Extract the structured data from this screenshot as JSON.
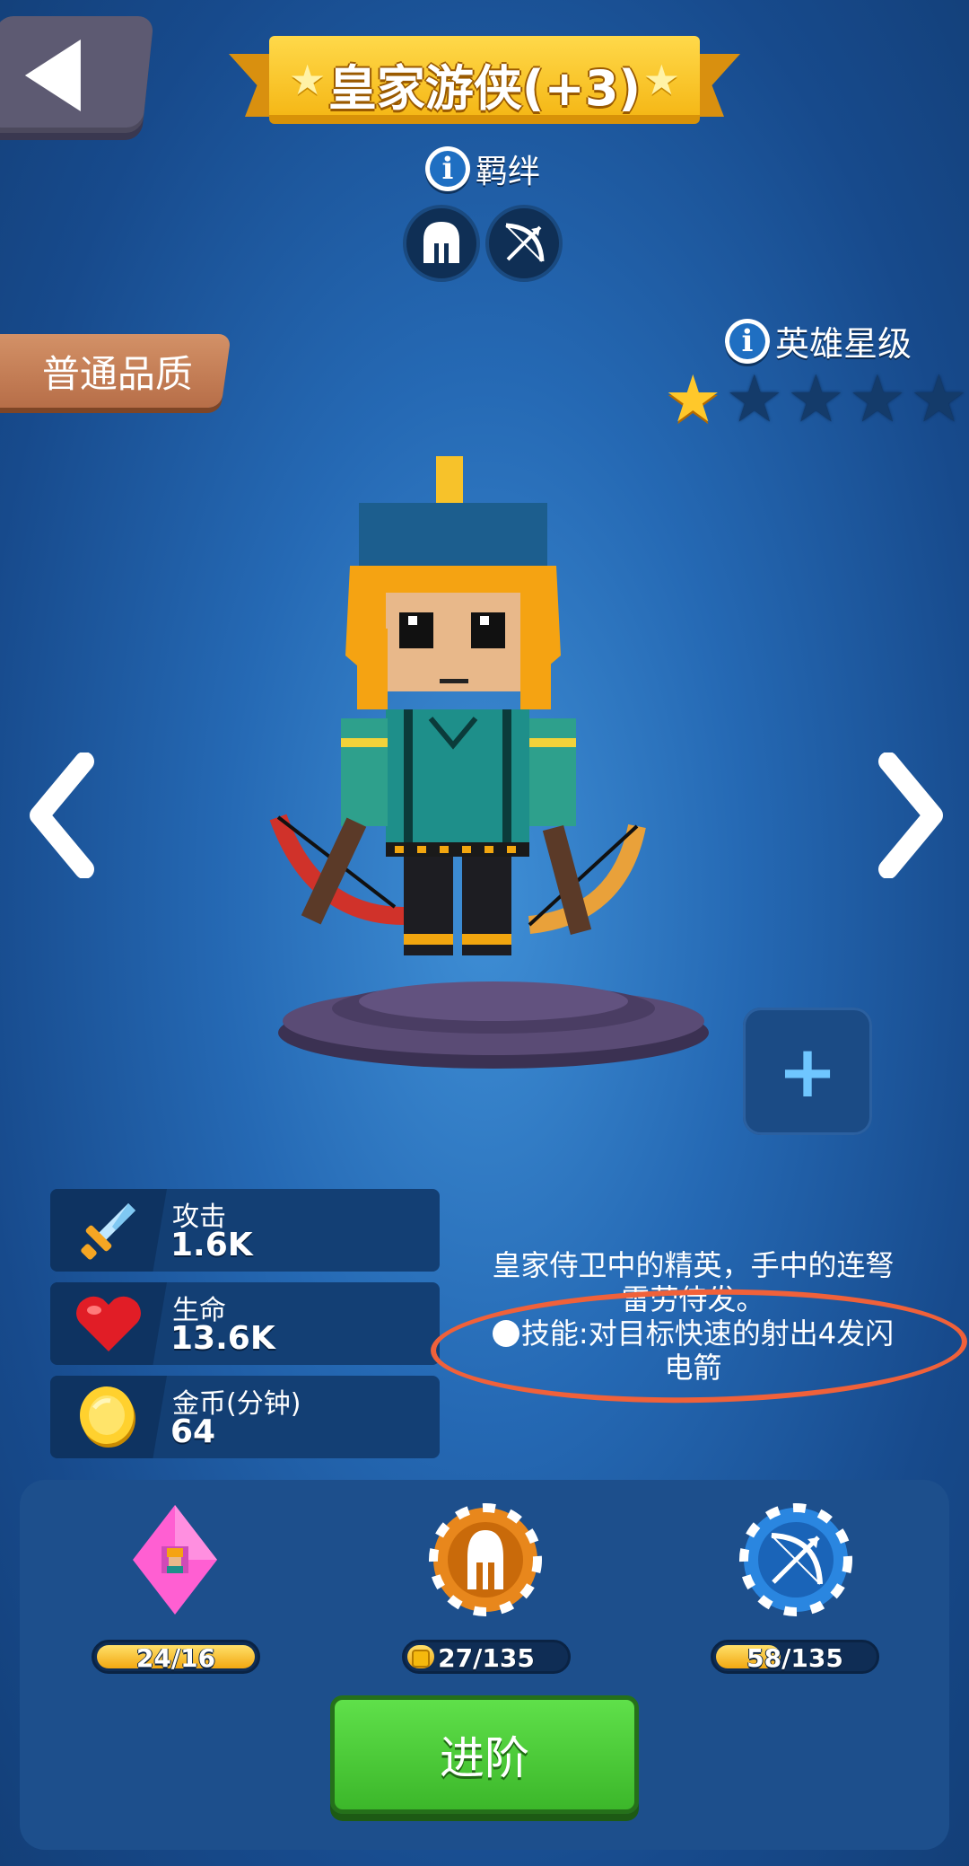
{
  "header": {
    "back_icon": "back-arrow-icon",
    "title": "皇家游侠(+3)"
  },
  "bond": {
    "label": "羁绊",
    "icons": [
      "helmet-icon",
      "bow-icon"
    ]
  },
  "quality": {
    "label": "普通品质"
  },
  "hero_star": {
    "label": "英雄星级",
    "filled": 1,
    "total": 5
  },
  "stats": [
    {
      "icon": "sword-icon",
      "label": "攻击",
      "value": "1.6K"
    },
    {
      "icon": "heart-icon",
      "label": "生命",
      "value": "13.6K"
    },
    {
      "icon": "gold-coin-icon",
      "label": "金币(分钟)",
      "value": "64"
    }
  ],
  "description": {
    "line1": "皇家侍卫中的精英，手中的连弩",
    "line2": "雷劳侍发。",
    "skill_line": "技能:对目标快速的射出4发闪",
    "skill_line2": "电箭"
  },
  "resources": [
    {
      "icon": "hero-card-icon",
      "text": "24/16",
      "progress": 1.0
    },
    {
      "icon": "helmet-token-icon",
      "text": "27/135",
      "progress": 0.2
    },
    {
      "icon": "bow-token-icon",
      "text": "58/135",
      "progress": 0.43
    }
  ],
  "advance_button": {
    "label": "进阶"
  },
  "colors": {
    "background": "#2569b4",
    "title_banner": "#f5b817",
    "advance_green": "#3cb72a",
    "star_on": "#ffc82a",
    "highlight_ellipse": "#f0613a"
  }
}
